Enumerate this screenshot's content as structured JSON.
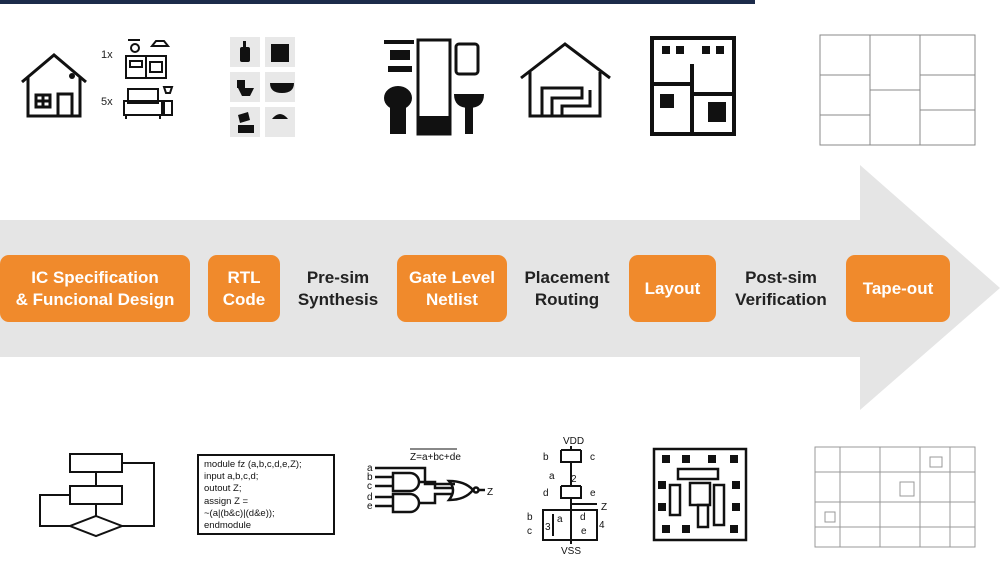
{
  "colors": {
    "accent": "#f08a2c",
    "arrow": "#e5e5e5",
    "topbar": "#1c2b4a"
  },
  "flow": {
    "steps": [
      {
        "kind": "box",
        "lines": [
          "IC Specification",
          "& Funcional Design"
        ]
      },
      {
        "kind": "box",
        "lines": [
          "RTL",
          "Code"
        ]
      },
      {
        "kind": "text",
        "lines": [
          "Pre-sim",
          "Synthesis"
        ]
      },
      {
        "kind": "box",
        "lines": [
          "Gate Level",
          "Netlist"
        ]
      },
      {
        "kind": "text",
        "lines": [
          "Placement",
          "Routing"
        ]
      },
      {
        "kind": "box",
        "lines": [
          "Layout"
        ]
      },
      {
        "kind": "text",
        "lines": [
          "Post-sim",
          "Verification"
        ]
      },
      {
        "kind": "box",
        "lines": [
          "Tape-out"
        ]
      }
    ]
  },
  "top_icons": {
    "count_kitchen": "1x",
    "count_bedroom": "5x"
  },
  "code": {
    "lines": [
      "module fz (a,b,c,d,e,Z);",
      "input a,b,c,d;",
      "outout Z;",
      "assign Z =",
      "~(a|(b&c)|(d&e));",
      "endmodule"
    ]
  },
  "gate": {
    "equation": "Z=a+bc+de",
    "inputs": [
      "a",
      "b",
      "c",
      "d",
      "e"
    ],
    "output": "Z"
  },
  "transistor": {
    "vdd": "VDD",
    "vss": "VSS",
    "labels": [
      "b",
      "c",
      "a",
      "2",
      "d",
      "e",
      "Z",
      "b",
      "c",
      "3",
      "a",
      "d",
      "e",
      "4"
    ]
  }
}
